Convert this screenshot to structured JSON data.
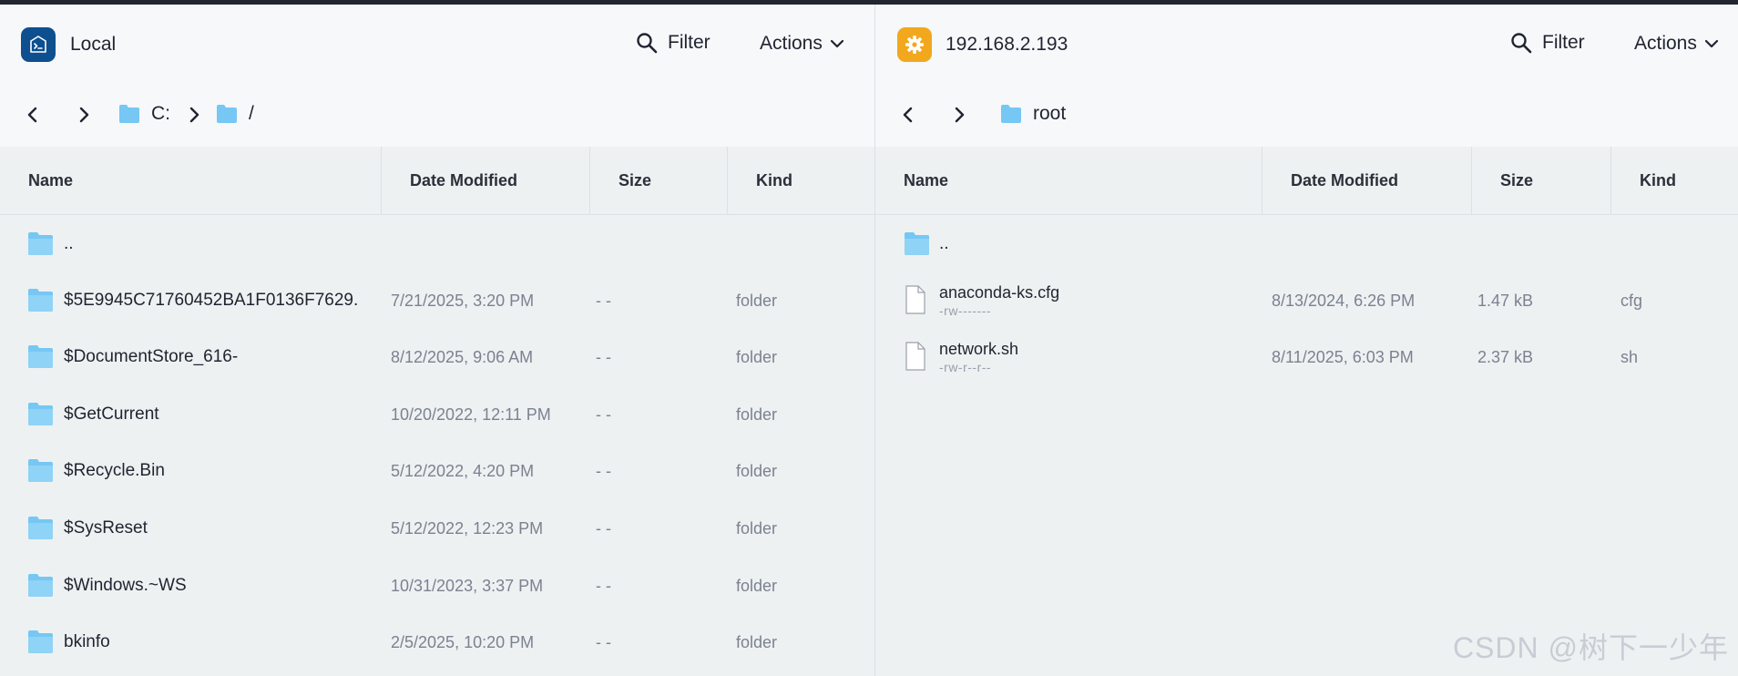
{
  "colors": {
    "local_icon_bg": "#0d4f8f",
    "remote_icon_bg": "#f2a81d",
    "folder": "#76c7f3",
    "accent_dark": "#1f2430"
  },
  "left": {
    "host_icon": "terminal-icon",
    "host_name": "Local",
    "filter_label": "Filter",
    "actions_label": "Actions",
    "breadcrumb": [
      "C:",
      "/"
    ],
    "columns": {
      "name": "Name",
      "date": "Date Modified",
      "size": "Size",
      "kind": "Kind"
    },
    "rows": [
      {
        "name": "..",
        "date": "",
        "size": "",
        "kind": ""
      },
      {
        "name": "$5E9945C71760452BA1F0136F7629...",
        "date": "7/21/2025, 3:20 PM",
        "size": "- -",
        "kind": "folder"
      },
      {
        "name": "$DocumentStore_616-",
        "date": "8/12/2025, 9:06 AM",
        "size": "- -",
        "kind": "folder"
      },
      {
        "name": "$GetCurrent",
        "date": "10/20/2022, 12:11 PM",
        "size": "- -",
        "kind": "folder"
      },
      {
        "name": "$Recycle.Bin",
        "date": "5/12/2022, 4:20 PM",
        "size": "- -",
        "kind": "folder"
      },
      {
        "name": "$SysReset",
        "date": "5/12/2022, 12:23 PM",
        "size": "- -",
        "kind": "folder"
      },
      {
        "name": "$Windows.~WS",
        "date": "10/31/2023, 3:37 PM",
        "size": "- -",
        "kind": "folder"
      },
      {
        "name": "bkinfo",
        "date": "2/5/2025, 10:20 PM",
        "size": "- -",
        "kind": "folder"
      }
    ]
  },
  "right": {
    "host_icon": "gear-icon",
    "host_name": "192.168.2.193",
    "filter_label": "Filter",
    "actions_label": "Actions",
    "breadcrumb": [
      "root"
    ],
    "columns": {
      "name": "Name",
      "date": "Date Modified",
      "size": "Size",
      "kind": "Kind"
    },
    "rows": [
      {
        "name": "..",
        "perm": "",
        "date": "",
        "size": "",
        "kind": ""
      },
      {
        "name": "anaconda-ks.cfg",
        "perm": "-rw-------",
        "date": "8/13/2024, 6:26 PM",
        "size": "1.47 kB",
        "kind": "cfg"
      },
      {
        "name": "network.sh",
        "perm": "-rw-r--r--",
        "date": "8/11/2025, 6:03 PM",
        "size": "2.37 kB",
        "kind": "sh"
      }
    ]
  },
  "watermark": "CSDN @树下一少年"
}
